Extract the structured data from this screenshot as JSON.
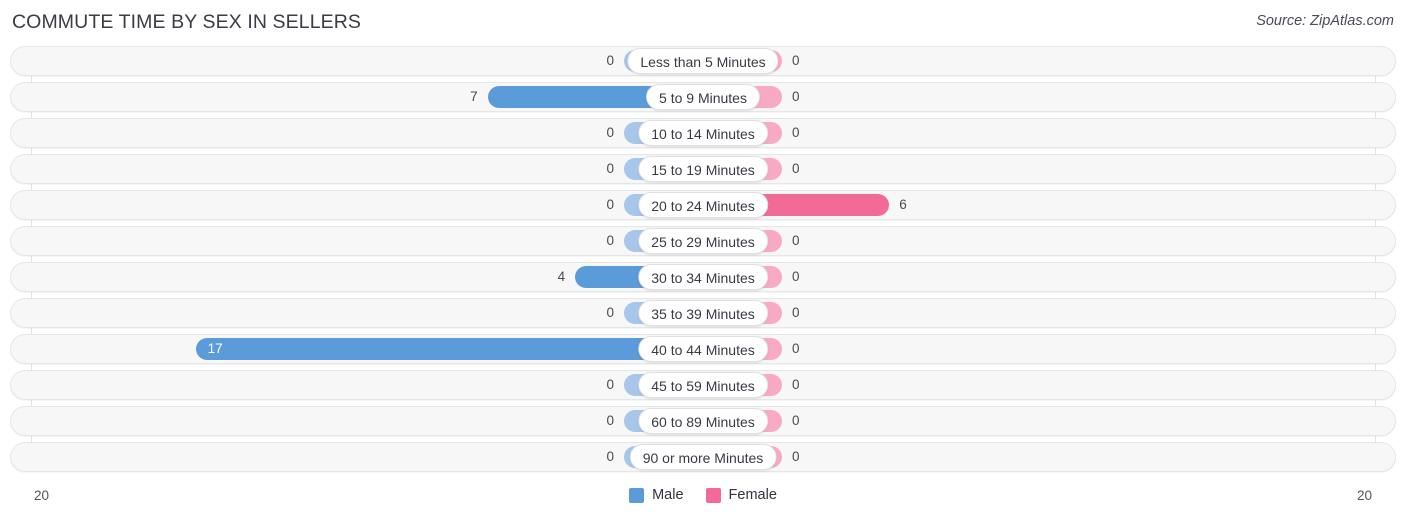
{
  "header": {
    "title": "COMMUTE TIME BY SEX IN SELLERS",
    "source": "Source: ZipAtlas.com"
  },
  "axis": {
    "left_end": "20",
    "right_end": "20"
  },
  "legend": {
    "items": [
      {
        "label": "Male",
        "color": "#5b9bd9"
      },
      {
        "label": "Female",
        "color": "#f26b96"
      }
    ]
  },
  "chart_data": {
    "type": "bar",
    "orientation": "horizontal-diverging",
    "title": "COMMUTE TIME BY SEX IN SELLERS",
    "xlabel": "",
    "ylabel": "",
    "xlim": [
      20,
      20
    ],
    "grid": true,
    "legend_position": "bottom-center",
    "categories": [
      "Less than 5 Minutes",
      "5 to 9 Minutes",
      "10 to 14 Minutes",
      "15 to 19 Minutes",
      "20 to 24 Minutes",
      "25 to 29 Minutes",
      "30 to 34 Minutes",
      "35 to 39 Minutes",
      "40 to 44 Minutes",
      "45 to 59 Minutes",
      "60 to 89 Minutes",
      "90 or more Minutes"
    ],
    "series": [
      {
        "name": "Male",
        "side": "left",
        "color": "#5b9bd9",
        "zero_color": "#a6c6ea",
        "values": [
          0,
          7,
          0,
          0,
          0,
          0,
          4,
          0,
          17,
          0,
          0,
          0
        ],
        "labels": [
          "0",
          "7",
          "0",
          "0",
          "0",
          "0",
          "4",
          "0",
          "17",
          "0",
          "0",
          "0"
        ]
      },
      {
        "name": "Female",
        "side": "right",
        "color": "#f26b96",
        "zero_color": "#f8aac5",
        "values": [
          0,
          0,
          0,
          0,
          6,
          0,
          0,
          0,
          0,
          0,
          0,
          0
        ],
        "labels": [
          "0",
          "0",
          "0",
          "0",
          "6",
          "0",
          "0",
          "0",
          "0",
          "0",
          "0",
          "0"
        ]
      }
    ]
  }
}
